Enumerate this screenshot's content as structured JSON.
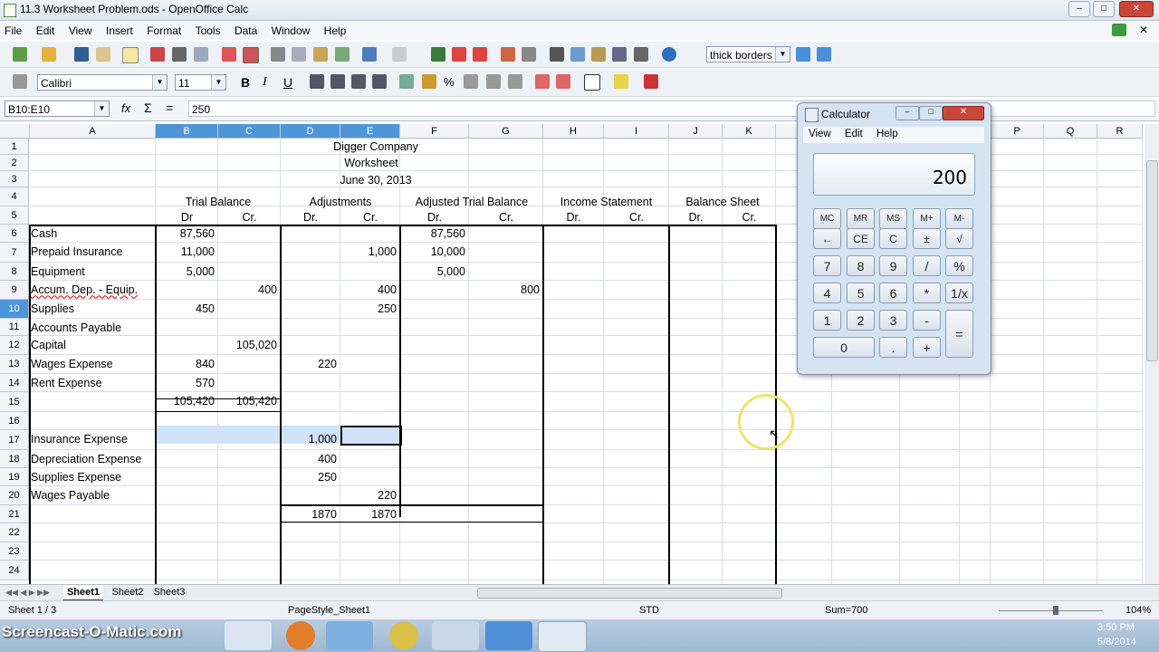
{
  "window": {
    "title": "11.3 Worksheet Problem.ods - OpenOffice Calc"
  },
  "menu": [
    "File",
    "Edit",
    "View",
    "Insert",
    "Format",
    "Tools",
    "Data",
    "Window",
    "Help"
  ],
  "toolbar": {
    "style_box": "thick borders"
  },
  "formatting": {
    "font_name": "Calibri",
    "font_size": "11"
  },
  "formula_bar": {
    "name_box": "B10:E10",
    "content": "250"
  },
  "columns": [
    "A",
    "B",
    "C",
    "D",
    "E",
    "F",
    "G",
    "H",
    "I",
    "J",
    "K",
    "L",
    "M",
    "N",
    "O",
    "P",
    "Q",
    "R"
  ],
  "rows": [
    "1",
    "2",
    "3",
    "4",
    "5",
    "6",
    "7",
    "8",
    "9",
    "10",
    "11",
    "12",
    "13",
    "14",
    "15",
    "16",
    "17",
    "18",
    "19",
    "20",
    "21",
    "22",
    "23",
    "24"
  ],
  "sheet": {
    "company": "Digger Company",
    "doc": "Worksheet",
    "date": "June 30, 2013",
    "headers": {
      "trial_balance": "Trial Balance",
      "adjustments": "Adjustments",
      "adjusted": "Adjusted Trial Balance",
      "income": "Income Statement",
      "balance": "Balance Sheet"
    },
    "subheaders": [
      "Dr",
      "Cr.",
      "Dr.",
      "Cr.",
      "Dr.",
      "Cr.",
      "Dr.",
      "Cr.",
      "Dr.",
      "Cr."
    ],
    "accounts": {
      "r6": "Cash",
      "r7": "Prepaid Insurance",
      "r8": "Equipment",
      "r9": "Accum. Dep. - Equip.",
      "r10": "Supplies",
      "r11": "Accounts Payable",
      "r12": "Capital",
      "r13": "Wages Expense",
      "r14": "Rent Expense",
      "r17": "Insurance Expense",
      "r18": "Depreciation Expense",
      "r19": "Supplies Expense",
      "r20": "Wages Payable"
    },
    "values": {
      "b6": "87,560",
      "f6": "87,560",
      "b7": "11,000",
      "e7": "1,000",
      "f7": "10,000",
      "b8": "5,000",
      "f8": "5,000",
      "c9": "400",
      "e9": "400",
      "g9": "800",
      "b10": "450",
      "e10": "250",
      "c12": "105,020",
      "b13": "840",
      "d13": "220",
      "b14": "570",
      "b15": "105,420",
      "c15": "105,420",
      "d17": "1,000",
      "d18": "400",
      "d19": "250",
      "e20": "220",
      "d21": "1870",
      "e21": "1870"
    }
  },
  "tabs": [
    "Sheet1",
    "Sheet2",
    "Sheet3"
  ],
  "status": {
    "sheet": "Sheet 1 / 3",
    "pagestyle": "PageStyle_Sheet1",
    "mode": "STD",
    "sum": "Sum=700",
    "zoom": "104%"
  },
  "calculator": {
    "title": "Calculator",
    "menu": [
      "View",
      "Edit",
      "Help"
    ],
    "display": "200",
    "keys": {
      "row1": [
        "MC",
        "MR",
        "MS",
        "M+",
        "M-"
      ],
      "row2": [
        "←",
        "CE",
        "C",
        "±",
        "√"
      ],
      "row3": [
        "7",
        "8",
        "9",
        "/",
        "%"
      ],
      "row4": [
        "4",
        "5",
        "6",
        "*",
        "1/x"
      ],
      "row5": [
        "1",
        "2",
        "3",
        "-"
      ],
      "row6": [
        "0",
        ".",
        "+"
      ],
      "equals": "="
    }
  },
  "taskbar": {
    "watermark": "Screencast-O-Matic.com",
    "time": "3:50 PM",
    "date": "5/8/2014"
  }
}
